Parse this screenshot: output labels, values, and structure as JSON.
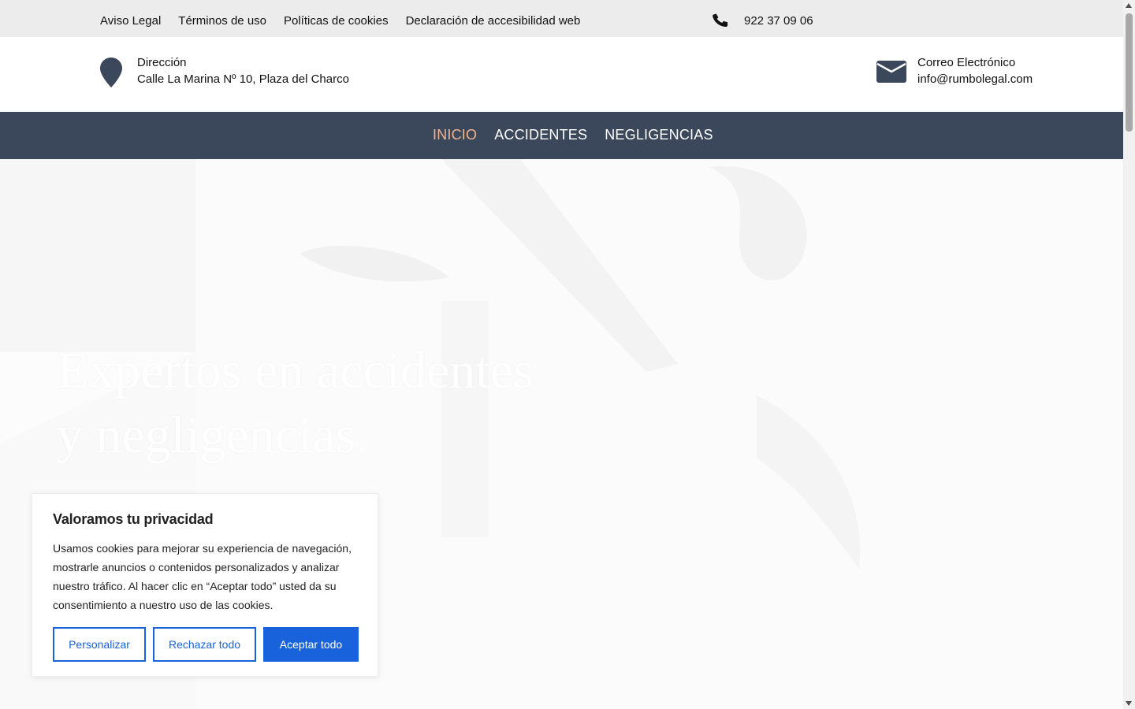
{
  "topbar": {
    "links": [
      "Aviso Legal",
      "Términos de uso",
      "Políticas de cookies",
      "Declaración de accesibilidad web"
    ],
    "phone": "922 37 09 06"
  },
  "info": {
    "address_label": "Dirección",
    "address_value": "Calle La Marina Nº 10, Plaza del Charco",
    "email_label": "Correo Electrónico",
    "email_value": "info@rumbolegal.com"
  },
  "nav": {
    "items": [
      "INICIO",
      "ACCIDENTES",
      "NEGLIGENCIAS"
    ],
    "active": "INICIO"
  },
  "hero": {
    "title_line1": "Expertos en accidentes",
    "title_line2": "y negligencias."
  },
  "cookie": {
    "title": "Valoramos tu privacidad",
    "body": "Usamos cookies para mejorar su experiencia de navegación, mostrarle anuncios o contenidos personalizados y analizar nuestro tráfico. Al hacer clic en “Aceptar todo” usted da su consentimiento a nuestro uso de las cookies.",
    "customize_label": "Personalizar",
    "reject_label": "Rechazar todo",
    "accept_label": "Aceptar todo"
  },
  "colors": {
    "nav_bg": "#3b475a",
    "nav_active": "#f3b58f",
    "topbar_bg": "#ececec",
    "cookie_accent": "#1863dc",
    "icon_color": "#3b475a"
  },
  "icons": {
    "phone": "phone-icon",
    "address": "map-pin-icon",
    "email": "envelope-icon"
  }
}
